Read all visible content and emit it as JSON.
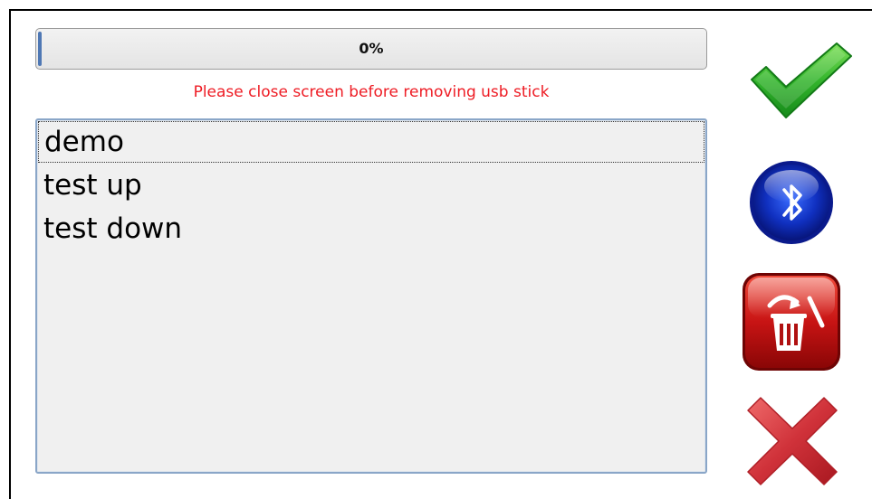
{
  "progress": {
    "percent_text": "0%",
    "value": 0.0
  },
  "warning_message": "Please close screen before removing usb stick",
  "file_list": {
    "items": [
      "demo",
      "test up",
      "test down"
    ],
    "selected_index": 0
  },
  "buttons": {
    "confirm_icon": "green-checkmark-icon",
    "bluetooth_icon": "bluetooth-icon",
    "delete_icon": "trash-delete-icon",
    "cancel_icon": "red-x-icon"
  },
  "colors": {
    "warning": "#ee1c24",
    "progress_fill": "#4f78b4",
    "list_border": "#8aa6c8",
    "confirm_green": "#2fb52f",
    "bluetooth_blue": "#1534c8",
    "delete_red": "#cc1010",
    "cancel_red": "#d0323a"
  }
}
